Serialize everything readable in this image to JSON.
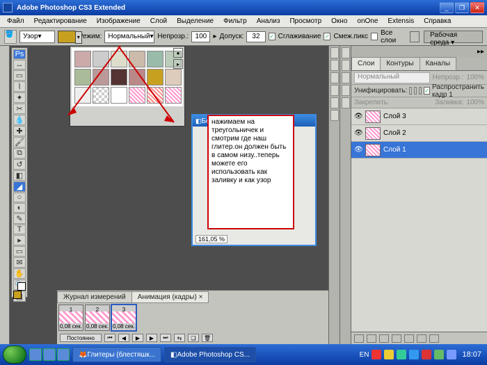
{
  "window": {
    "title": "Adobe Photoshop CS3 Extended"
  },
  "menu": [
    "Файл",
    "Редактирование",
    "Изображение",
    "Слой",
    "Выделение",
    "Фильтр",
    "Анализ",
    "Просмотр",
    "Окно",
    "onOne",
    "Extensis",
    "Справка"
  ],
  "opt": {
    "fill_mode": "Узор",
    "mode_label": "Режим:",
    "mode_value": "Нормальный",
    "opacity_label": "Непрозр.:",
    "opacity_value": "100",
    "tolerance_label": "Допуск:",
    "tolerance_value": "32",
    "aa": "Сглаживание",
    "contig": "Смеж.пикс",
    "all": "Все слои",
    "workspace": "Рабочая среда"
  },
  "doc": {
    "title": "Безымян",
    "zoom": "161,05 %"
  },
  "annotation": "нажимаем на треугольничек и смотрим где наш глитер.он должен быть в самом низу..теперь можете его использовать как заливку и как узор",
  "layers_panel": {
    "tabs": [
      "Слои",
      "Контуры",
      "Каналы"
    ],
    "blend": "Нормальный",
    "opacity_label": "Непрозр.:",
    "opacity_value": "100%",
    "lock_label": "Унифицировать:",
    "spread": "Распространить кадр 1",
    "lockrow2_a": "Закрепить:",
    "lockrow2_b": "Заливка:",
    "lockrow2_v": "100%",
    "layers": [
      {
        "name": "Слой 3"
      },
      {
        "name": "Слой 2"
      },
      {
        "name": "Слой 1"
      }
    ]
  },
  "anim": {
    "tabs": [
      "Журнал измерений",
      "Анимация (кадры)"
    ],
    "dur": "0,08 сек.",
    "repeat": "Постоянно"
  },
  "taskbar": {
    "tasks": [
      "Глитеры (блестяшк...",
      "Adobe Photoshop CS..."
    ],
    "lang": "EN",
    "time": "18:07"
  }
}
